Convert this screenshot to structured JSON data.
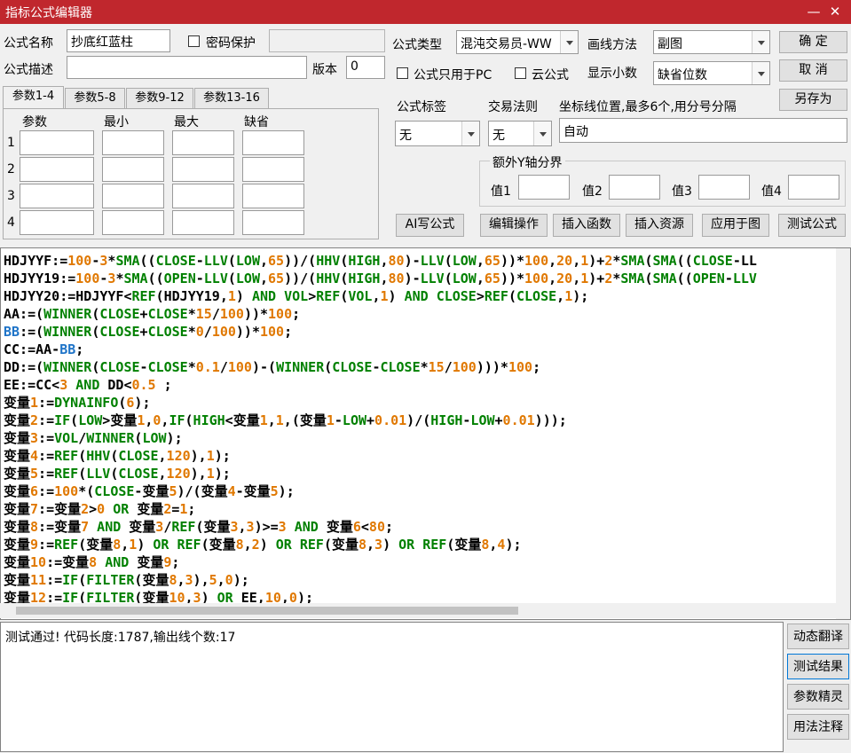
{
  "window": {
    "title": "指标公式编辑器"
  },
  "form": {
    "name_label": "公式名称",
    "name_value": "抄底红蓝柱",
    "password_label": "密码保护",
    "type_label": "公式类型",
    "type_value": "混沌交易员-WW",
    "draw_label": "画线方法",
    "draw_value": "副图",
    "desc_label": "公式描述",
    "version_label": "版本",
    "version_value": "0",
    "pc_only_label": "公式只用于PC",
    "cloud_label": "云公式",
    "decimals_label": "显示小数",
    "decimals_value": "缺省位数",
    "tag_label": "公式标签",
    "tag_value": "无",
    "rule_label": "交易法则",
    "rule_value": "无",
    "axis_label": "坐标线位置,最多6个,用分号分隔",
    "axis_value": "自动",
    "yaxis_group_label": "额外Y轴分界",
    "yaxis_values": [
      "值1",
      "值2",
      "值3",
      "值4"
    ]
  },
  "tabs": [
    "参数1-4",
    "参数5-8",
    "参数9-12",
    "参数13-16"
  ],
  "params": {
    "headers": [
      "参数",
      "最小",
      "最大",
      "缺省"
    ],
    "rows": [
      "1",
      "2",
      "3",
      "4"
    ]
  },
  "buttons": {
    "ok": "确 定",
    "cancel": "取 消",
    "save_as": "另存为",
    "ai": "AI写公式",
    "edit_ops": "编辑操作",
    "insert_fn": "插入函数",
    "insert_res": "插入资源",
    "apply": "应用于图",
    "test": "测试公式"
  },
  "side_buttons": [
    "动态翻译",
    "测试结果",
    "参数精灵",
    "用法注释"
  ],
  "output": {
    "text": "测试通过! 代码长度:1787,输出线个数:17"
  },
  "code_lines": [
    "HDJYYF:=100-3*SMA((CLOSE-LLV(LOW,65))/(HHV(HIGH,80)-LLV(LOW,65))*100,20,1)+2*SMA(SMA((CLOSE-LL",
    "HDJYY19:=100-3*SMA((OPEN-LLV(LOW,65))/(HHV(HIGH,80)-LLV(LOW,65))*100,20,1)+2*SMA(SMA((OPEN-LLV",
    "HDJYY20:=HDJYYF<REF(HDJYY19,1) AND VOL>REF(VOL,1) AND CLOSE>REF(CLOSE,1);",
    "AA:=(WINNER(CLOSE+CLOSE*15/100))*100;",
    "BB:=(WINNER(CLOSE+CLOSE*0/100))*100;",
    "CC:=AA-BB;",
    "DD:=(WINNER(CLOSE-CLOSE*0.1/100)-(WINNER(CLOSE-CLOSE*15/100)))*100;",
    "EE:=CC<3 AND DD<0.5 ;",
    "变量1:=DYNAINFO(6);",
    "变量2:=IF(LOW>变量1,0,IF(HIGH<变量1,1,(变量1-LOW+0.01)/(HIGH-LOW+0.01)));",
    "变量3:=VOL/WINNER(LOW);",
    "变量4:=REF(HHV(CLOSE,120),1);",
    "变量5:=REF(LLV(CLOSE,120),1);",
    "变量6:=100*(CLOSE-变量5)/(变量4-变量5);",
    "变量7:=变量2>0 OR 变量2=1;",
    "变量8:=变量7 AND 变量3/REF(变量3,3)>=3 AND 变量6<80;",
    "变量9:=REF(变量8,1) OR REF(变量8,2) OR REF(变量8,3) OR REF(变量8,4);",
    "变量10:=变量8 AND 变量9;",
    "变量11:=IF(FILTER(变量8,3),5,0);",
    "变量12:=IF(FILTER(变量10,3) OR EE,10,0);"
  ]
}
